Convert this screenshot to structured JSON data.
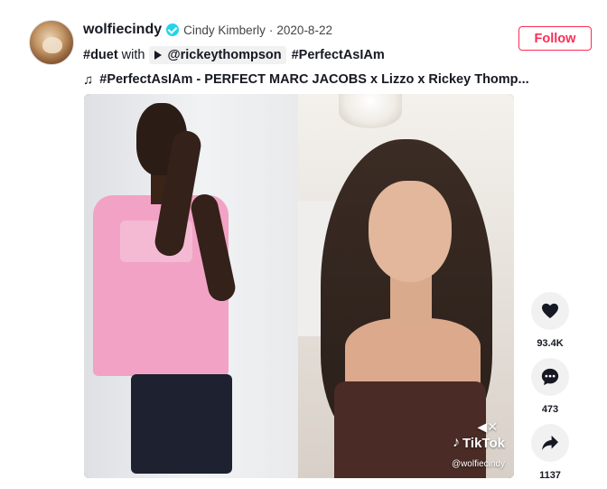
{
  "author": {
    "username": "wolfiecindy",
    "nickname": "Cindy Kimberly",
    "separator": "·",
    "date": "2020-8-22"
  },
  "caption": {
    "tag1": "#duet",
    "with_text": "with",
    "mention": "@rickeythompson",
    "tag2": "#PerfectAsIAm"
  },
  "music": {
    "icon": "music-note-icon",
    "title": "#PerfectAsIAm - PERFECT MARC JACOBS x Lizzo x Rickey Thomp..."
  },
  "follow_label": "Follow",
  "watermark": {
    "brand": "TikTok",
    "user": "@wolfiecindy"
  },
  "actions": {
    "likes": "93.4K",
    "comments": "473",
    "shares": "1137"
  },
  "colors": {
    "accent": "#fe2c55",
    "verified": "#20d5ec",
    "text": "#161823"
  }
}
